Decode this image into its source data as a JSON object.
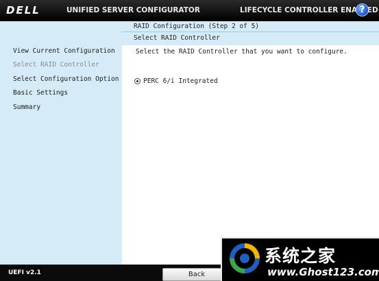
{
  "header": {
    "logo": "DELL",
    "title": "UNIFIED SERVER CONFIGURATOR",
    "status": "LIFECYCLE CONTROLLER ENABLED",
    "help_icon": "help-icon"
  },
  "wizard": {
    "step": "RAID Configuration (Step 2 of 5)",
    "page_title": "Select RAID Controller"
  },
  "sidebar": {
    "items": [
      {
        "label": "View Current Configuration",
        "state": "enabled"
      },
      {
        "label": "Select RAID Controller",
        "state": "current"
      },
      {
        "label": "Select Configuration Option",
        "state": "enabled"
      },
      {
        "label": "Basic Settings",
        "state": "enabled"
      },
      {
        "label": "Summary",
        "state": "enabled"
      }
    ]
  },
  "main": {
    "instruction": "Select the RAID Controller that you want to configure.",
    "controllers": [
      {
        "label": "PERC 6/i Integrated",
        "selected": true
      }
    ]
  },
  "footer": {
    "version": "UEFI v2.1",
    "back_label": "Back"
  },
  "watermark": {
    "title": "系统之家",
    "url": "www.Ghost123.com"
  }
}
